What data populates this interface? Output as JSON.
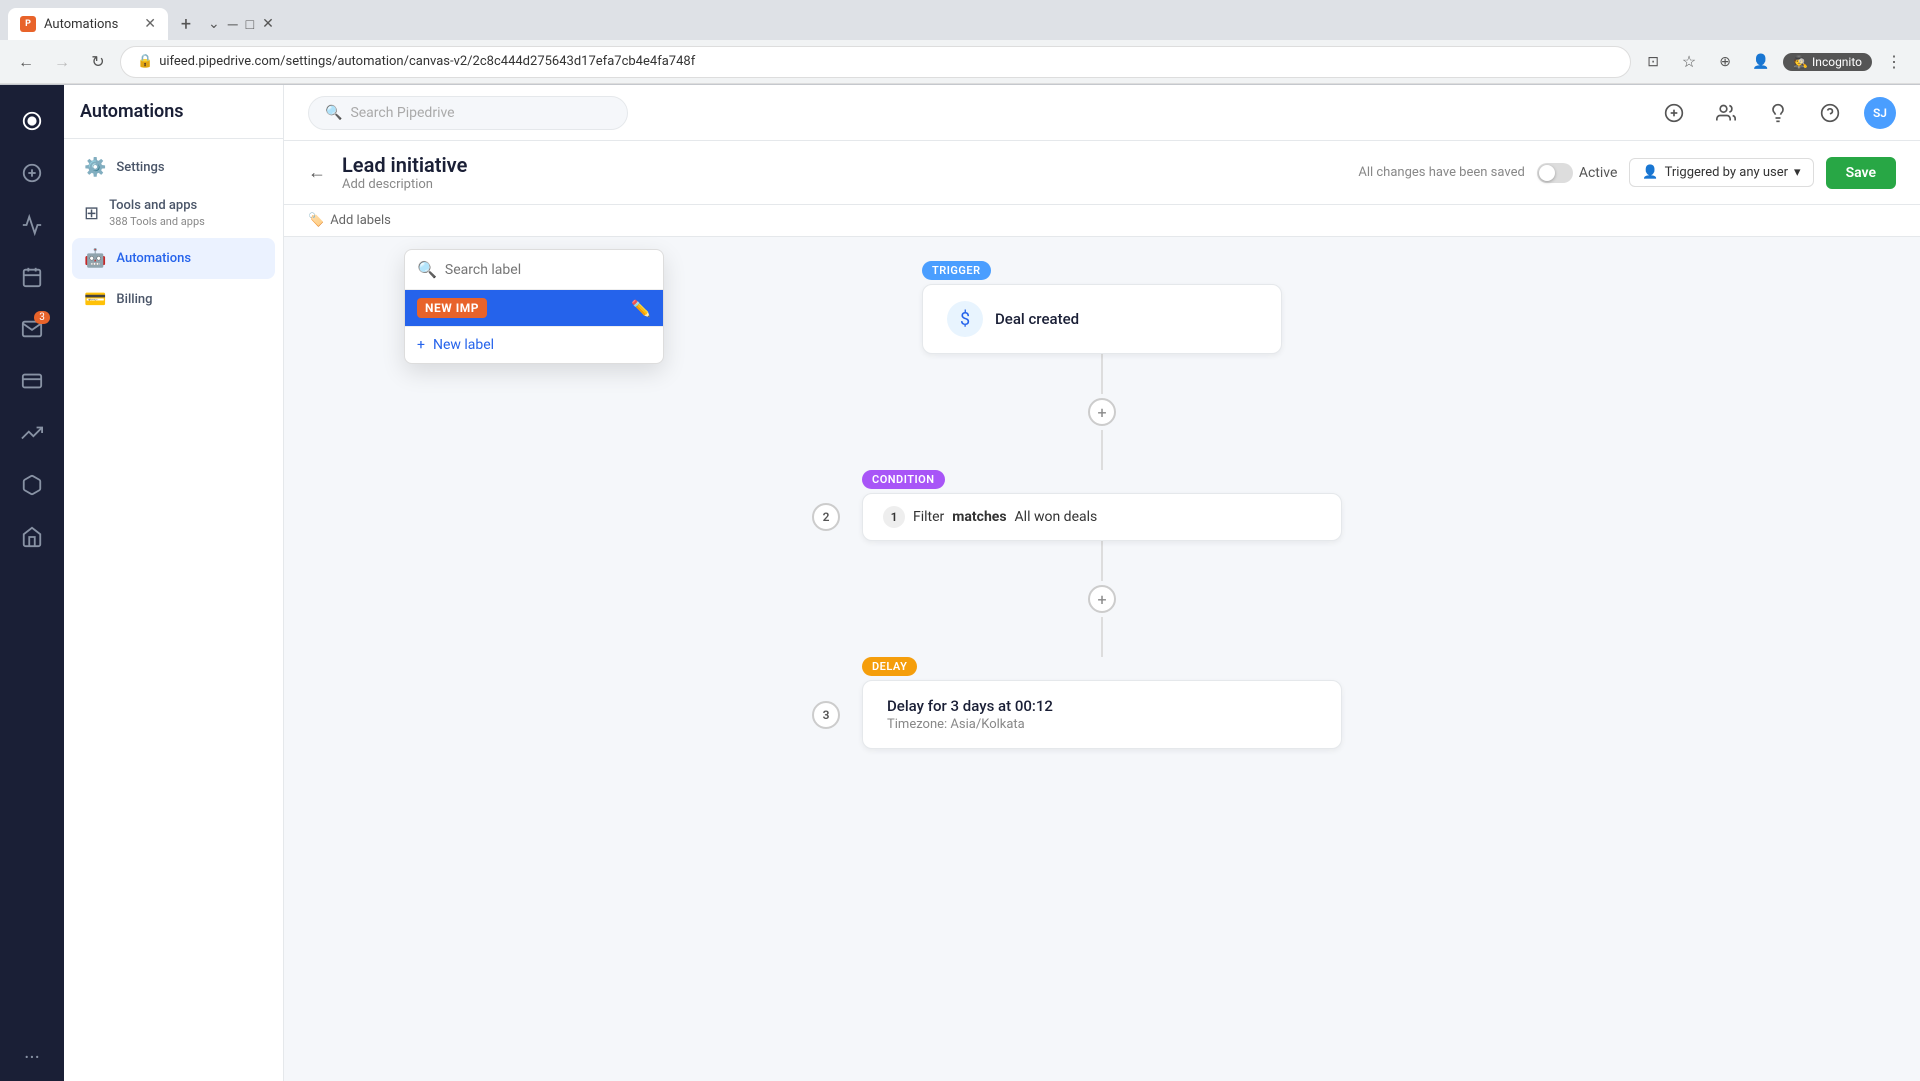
{
  "browser": {
    "tab_title": "Automations",
    "favicon": "P",
    "address": "uifeed.pipedrive.com/settings/automation/canvas-v2/2c8c444d275643d17efa7cb4e4fa748f",
    "incognito": "Incognito"
  },
  "app": {
    "sidebar_title": "Automations",
    "nav": {
      "settings_label": "Settings",
      "tools_label": "Tools and apps",
      "tools_count": "388",
      "automations_label": "Automations",
      "billing_label": "Billing",
      "badge": "3"
    }
  },
  "topbar": {
    "search_placeholder": "Search Pipedrive"
  },
  "automation": {
    "back": "←",
    "title": "Lead initiative",
    "description": "Add description",
    "saved_text": "All changes have been saved",
    "active_label": "Active",
    "triggered_label": "Triggered by any user",
    "save_label": "Save",
    "add_labels": "Add labels"
  },
  "label_dropdown": {
    "search_placeholder": "Search label",
    "existing_label": "NEW IMP",
    "new_label": "New label"
  },
  "canvas": {
    "trigger": {
      "badge": "TRIGGER",
      "title": "Deal created"
    },
    "condition": {
      "badge": "CONDITION",
      "step_num": "2",
      "filter_num": "1",
      "filter_text": "Filter",
      "filter_bold": "matches",
      "filter_value": "All won deals"
    },
    "delay": {
      "badge": "DELAY",
      "step_num": "3",
      "title": "Delay for 3 days at 00:12",
      "subtitle": "Timezone: Asia/Kolkata"
    }
  }
}
